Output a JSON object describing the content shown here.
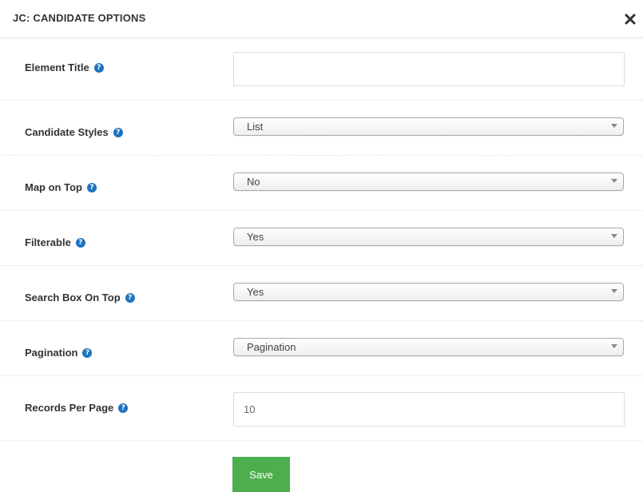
{
  "dialog": {
    "title": "JC: CANDIDATE OPTIONS",
    "close_icon": "close-icon"
  },
  "fields": {
    "element_title": {
      "label": "Element Title",
      "value": "",
      "placeholder": ""
    },
    "candidate_styles": {
      "label": "Candidate Styles",
      "selected": "List"
    },
    "map_on_top": {
      "label": "Map on Top",
      "selected": "No"
    },
    "filterable": {
      "label": "Filterable",
      "selected": "Yes"
    },
    "search_box_on_top": {
      "label": "Search Box On Top",
      "selected": "Yes"
    },
    "pagination": {
      "label": "Pagination",
      "selected": "Pagination"
    },
    "records_per_page": {
      "label": "Records Per Page",
      "value": "10"
    }
  },
  "help_icon_glyph": "?",
  "actions": {
    "save_label": "Save"
  },
  "colors": {
    "help_icon": "#1e73be",
    "save_button": "#4cae4c"
  }
}
